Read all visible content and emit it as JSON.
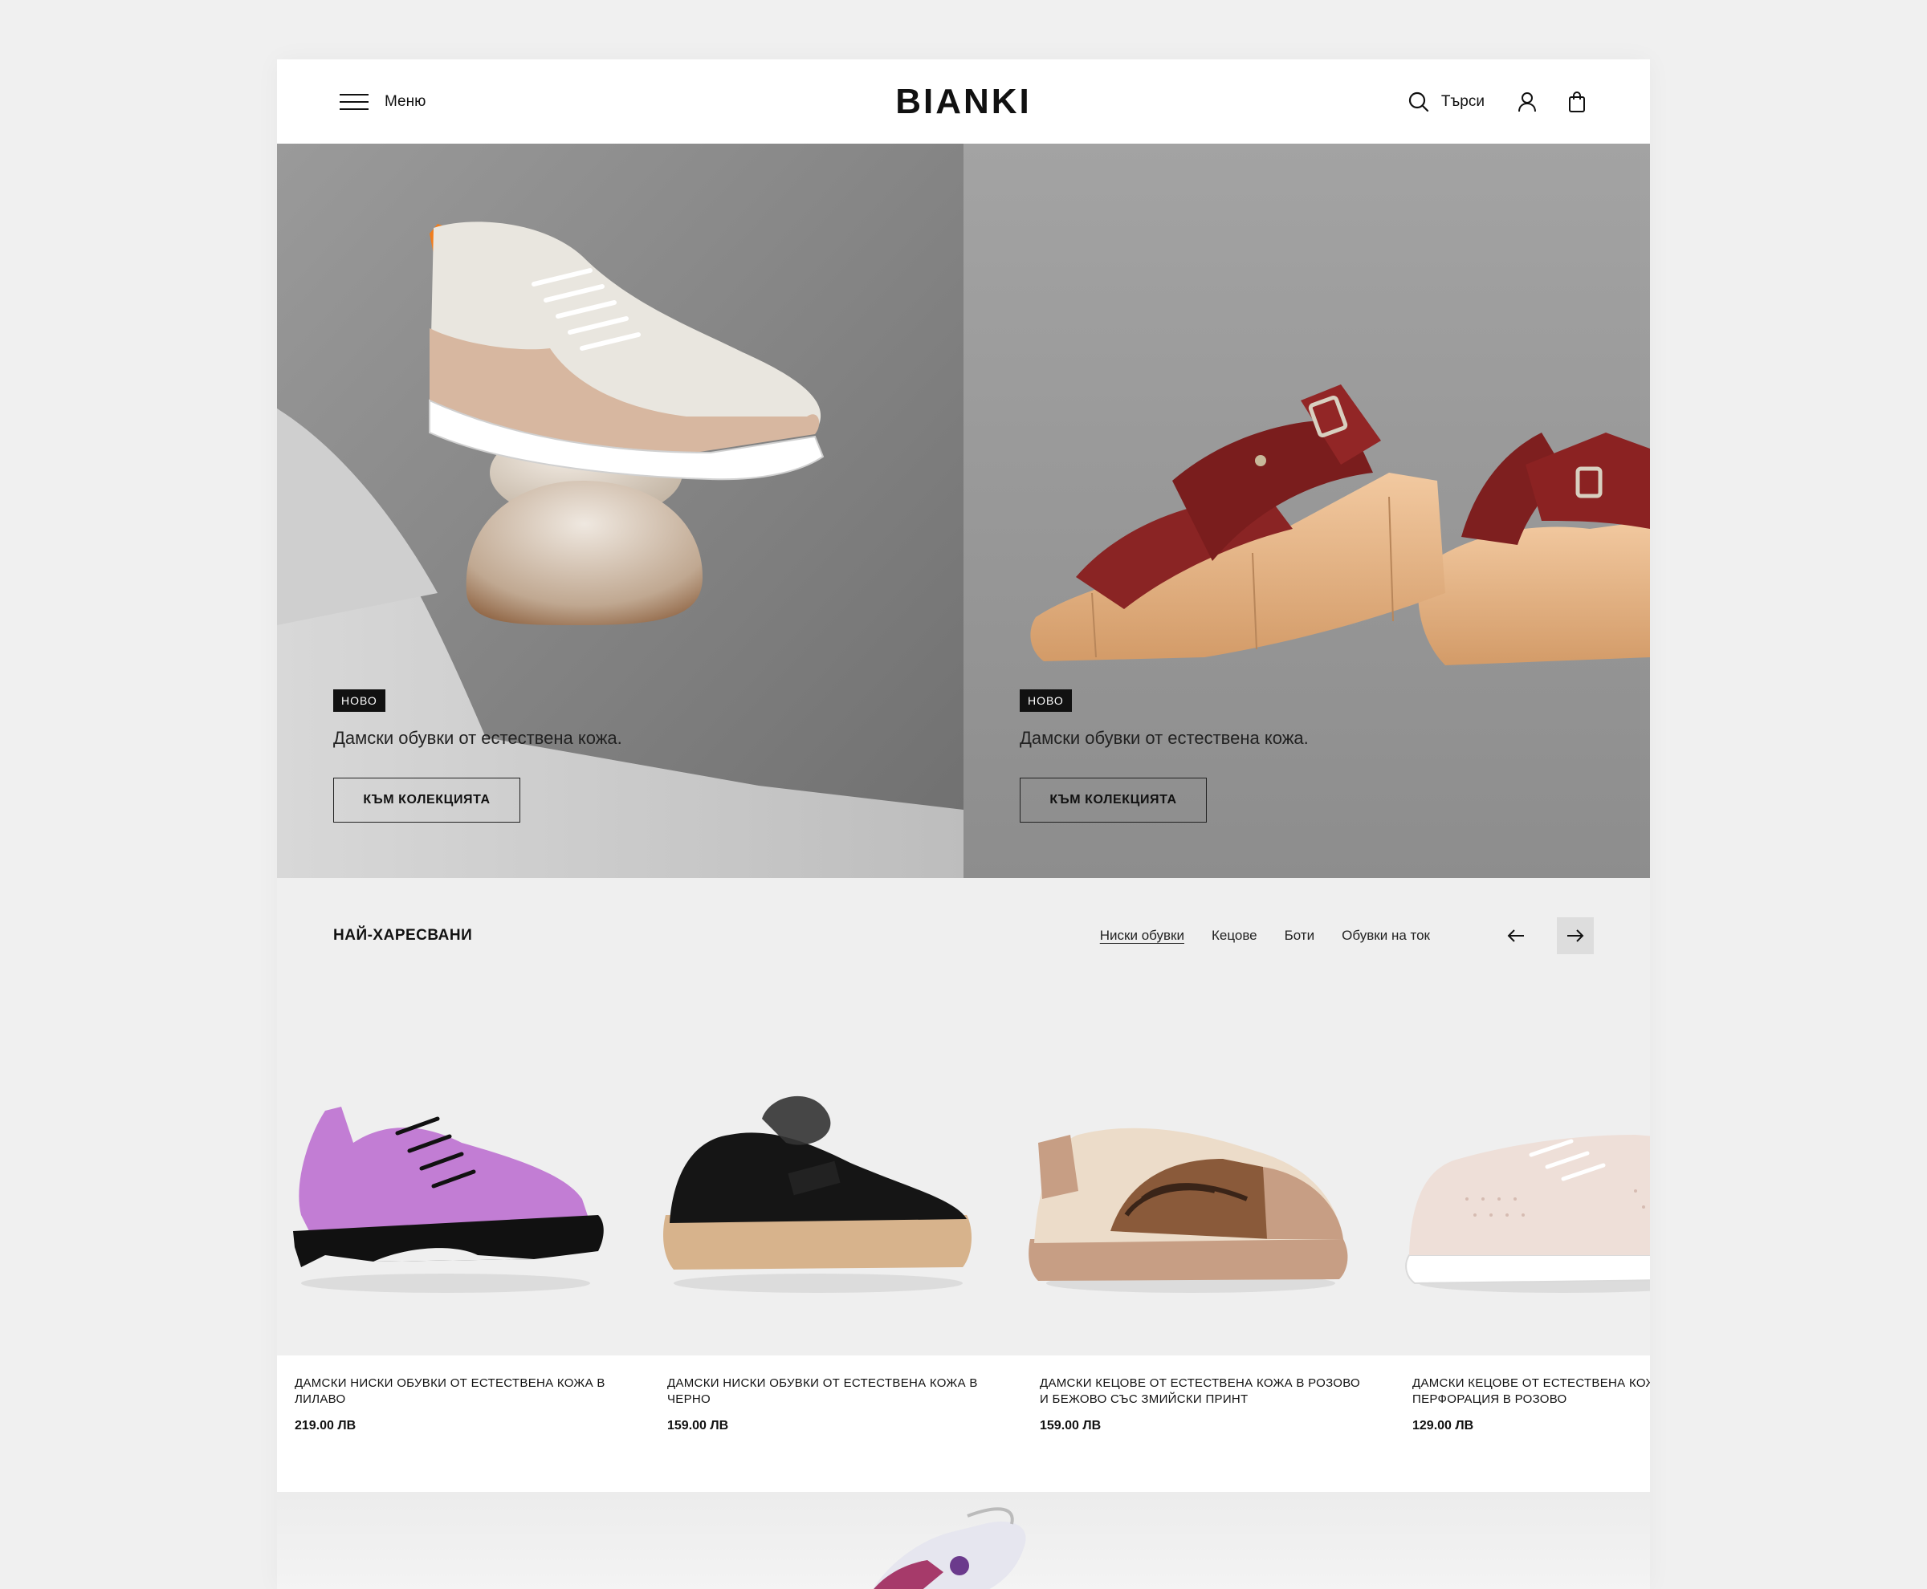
{
  "header": {
    "menu_label": "Меню",
    "logo": "BIANKI",
    "search_label": "Търси",
    "icons": [
      "hamburger-icon",
      "search-icon",
      "user-icon",
      "bag-icon"
    ]
  },
  "hero": [
    {
      "badge": "НОВО",
      "description": "Дамски обувки от естествена кожа.",
      "button": "КЪМ КОЛЕКЦИЯТА"
    },
    {
      "badge": "НОВО",
      "description": "Дамски обувки от естествена кожа.",
      "button": "КЪМ КОЛЕКЦИЯТА"
    }
  ],
  "liked": {
    "title": "НАЙ-ХАРЕСВАНИ",
    "tabs": [
      "Ниски обувки",
      "Кецове",
      "Боти",
      "Обувки на ток"
    ],
    "active_tab": "Ниски обувки",
    "products": [
      {
        "name": "ДАМСКИ НИСКИ ОБУВКИ ОТ ЕСТЕСТВЕНА КОЖА В ЛИЛАВО",
        "price": "219.00 ЛВ"
      },
      {
        "name": "ДАМСКИ НИСКИ ОБУВКИ ОТ ЕСТЕСТВЕНА КОЖА В ЧЕРНО",
        "price": "159.00 ЛВ"
      },
      {
        "name": "ДАМСКИ КЕЦОВЕ ОТ ЕСТЕСТВЕНА КОЖА В РОЗОВО И БЕЖОВО СЪС ЗМИЙСКИ ПРИНТ",
        "price": "159.00 ЛВ"
      },
      {
        "name": "ДАМСКИ КЕЦОВЕ ОТ ЕСТЕСТВЕНА КОЖА С ПЕРФОРАЦИЯ В РОЗОВО",
        "price": "129.00 ЛВ"
      }
    ]
  },
  "colors": {
    "accent": "#111111",
    "page_bg": "#f0f0f0",
    "hero_bg": "#8e8e8e"
  }
}
